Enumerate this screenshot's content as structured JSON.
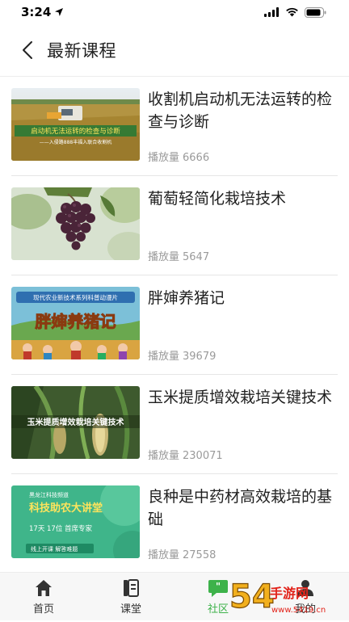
{
  "status_bar": {
    "time": "3:24"
  },
  "header": {
    "title": "最新课程"
  },
  "courses": [
    {
      "title": "收割机启动机无法运转的检查与诊断",
      "plays_label": "播放量",
      "plays": "6666",
      "thumb_text_main": "启动机无法运转的检查与诊断",
      "thumb_text_sub": "——入侵路888丰福入联合收割机"
    },
    {
      "title": "葡萄轻简化栽培技术",
      "plays_label": "播放量",
      "plays": "5647"
    },
    {
      "title": "胖婶养猪记",
      "plays_label": "播放量",
      "plays": "39679",
      "thumb_text_top": "现代农业新技术系列科普动漫片",
      "thumb_text_main": "胖婶养猪记"
    },
    {
      "title": "玉米提质增效栽培关键技术",
      "plays_label": "播放量",
      "plays": "230071",
      "thumb_text_main": "玉米提质增效栽培关键技术"
    },
    {
      "title": "良种是中药材高效栽培的基础",
      "plays_label": "播放量",
      "plays": "27558",
      "thumb_text_top": "黑龙江科技频道",
      "thumb_text_main": "科技助农大讲堂",
      "thumb_text_line": "17天 17位 首席专家",
      "thumb_text_bottom": "线上开课 解答难题"
    }
  ],
  "tabs": [
    {
      "label": "首页",
      "icon": "home-icon"
    },
    {
      "label": "课堂",
      "icon": "book-icon"
    },
    {
      "label": "社区",
      "icon": "chat-icon",
      "active": true
    },
    {
      "label": "我的",
      "icon": "user-icon"
    }
  ],
  "watermark": {
    "text": "5419手游网",
    "sub": "www.5419.cn"
  },
  "colors": {
    "accent": "#3db24a",
    "muted": "#9a9a9a",
    "divider": "#e6e6e6"
  }
}
